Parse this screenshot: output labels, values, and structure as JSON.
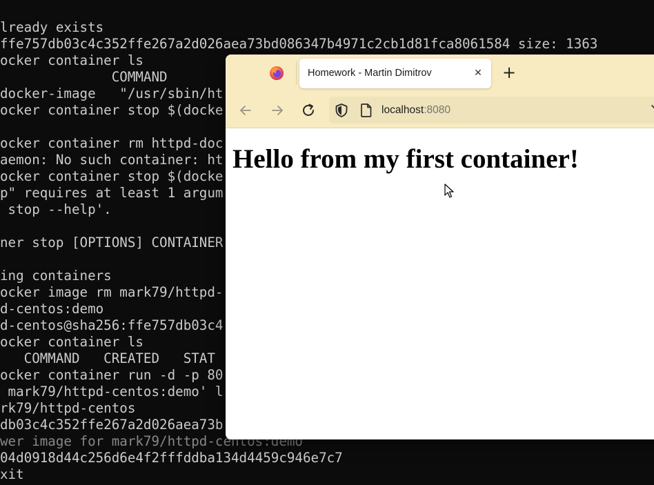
{
  "terminal": {
    "lines": [
      {
        "text": "lready exists",
        "dim": false
      },
      {
        "text": "ffe757db03c4c352ffe267a2d026aea73bd086347b4971c2cb1d81fca8061584 size: 1363",
        "dim": false
      },
      {
        "text": "ocker container ls",
        "dim": false
      },
      {
        "text": "              COMMAND",
        "dim": false
      },
      {
        "text": "docker-image   \"/usr/sbin/ht",
        "dim": false
      },
      {
        "text": "ocker container stop $(docke",
        "dim": false
      },
      {
        "text": "",
        "dim": false
      },
      {
        "text": "ocker container rm httpd-doc",
        "dim": false
      },
      {
        "text": "aemon: No such container: ht",
        "dim": false
      },
      {
        "text": "ocker container stop $(docke",
        "dim": false
      },
      {
        "text": "p\" requires at least 1 argum",
        "dim": false
      },
      {
        "text": " stop --help'.",
        "dim": false
      },
      {
        "text": "",
        "dim": false
      },
      {
        "text": "ner stop [OPTIONS] CONTAINER",
        "dim": false
      },
      {
        "text": "",
        "dim": false
      },
      {
        "text": "ing containers",
        "dim": false
      },
      {
        "text": "ocker image rm mark79/httpd-",
        "dim": false
      },
      {
        "text": "d-centos:demo",
        "dim": false
      },
      {
        "text": "d-centos@sha256:ffe757db03c4",
        "dim": false
      },
      {
        "text": "ocker container ls",
        "dim": false
      },
      {
        "text": "   COMMAND   CREATED   STAT",
        "dim": false
      },
      {
        "text": "ocker container run -d -p 80",
        "dim": false
      },
      {
        "text": " mark79/httpd-centos:demo' l",
        "dim": false
      },
      {
        "text": "rk79/httpd-centos",
        "dim": false
      },
      {
        "text": "db03c4c352ffe267a2d026aea73b",
        "dim": false
      },
      {
        "text": "wer image for mark79/httpd-centos:demo",
        "dim": true
      },
      {
        "text": "04d0918d44c256d6e4f2fffddba134d4459c946e7c7",
        "dim": false
      },
      {
        "text": "xit",
        "dim": false
      }
    ]
  },
  "browser": {
    "tab_title": "Homework - Martin Dimitrov",
    "tab_close_glyph": "✕",
    "new_tab_glyph": "+",
    "url_host": "localhost",
    "url_port": ":8080",
    "page_heading": "Hello from my first container!",
    "colors": {
      "chrome": "#f8ebc2",
      "urlbar": "#efe3bb"
    },
    "icons": [
      "firefox-icon",
      "back-arrow-icon",
      "forward-arrow-icon",
      "reload-icon",
      "shield-icon",
      "page-icon",
      "chevron-down-icon",
      "mouse-pointer-icon"
    ]
  }
}
